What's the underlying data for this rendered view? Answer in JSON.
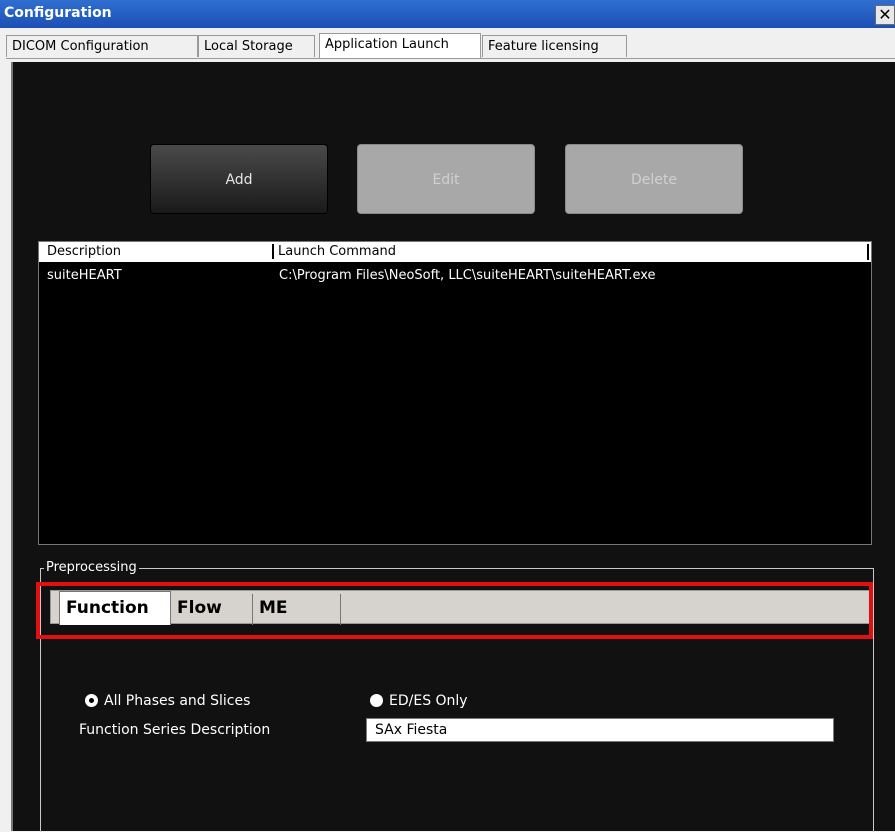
{
  "window": {
    "title": "Configuration",
    "close_glyph": "✕"
  },
  "tabs": [
    {
      "label": "DICOM Configuration"
    },
    {
      "label": "Local Storage"
    },
    {
      "label": "Application Launch"
    },
    {
      "label": "Feature licensing"
    }
  ],
  "buttons": {
    "add": "Add",
    "edit": "Edit",
    "delete": "Delete"
  },
  "table": {
    "columns": [
      "Description",
      "Launch Command"
    ],
    "rows": [
      {
        "description": "suiteHEART",
        "command": "C:\\Program Files\\NeoSoft, LLC\\suiteHEART\\suiteHEART.exe"
      }
    ]
  },
  "preprocessing": {
    "label": "Preprocessing",
    "subtabs": [
      "Function",
      "Flow",
      "ME"
    ],
    "options": {
      "all_phases": "All Phases and Slices",
      "ed_es": "ED/ES Only"
    },
    "series_label": "Function Series Description",
    "series_value": "SAx Fiesta"
  },
  "colors": {
    "highlight": "#e01010",
    "panel": "#111111",
    "title_bar": "#1c4fb5"
  }
}
